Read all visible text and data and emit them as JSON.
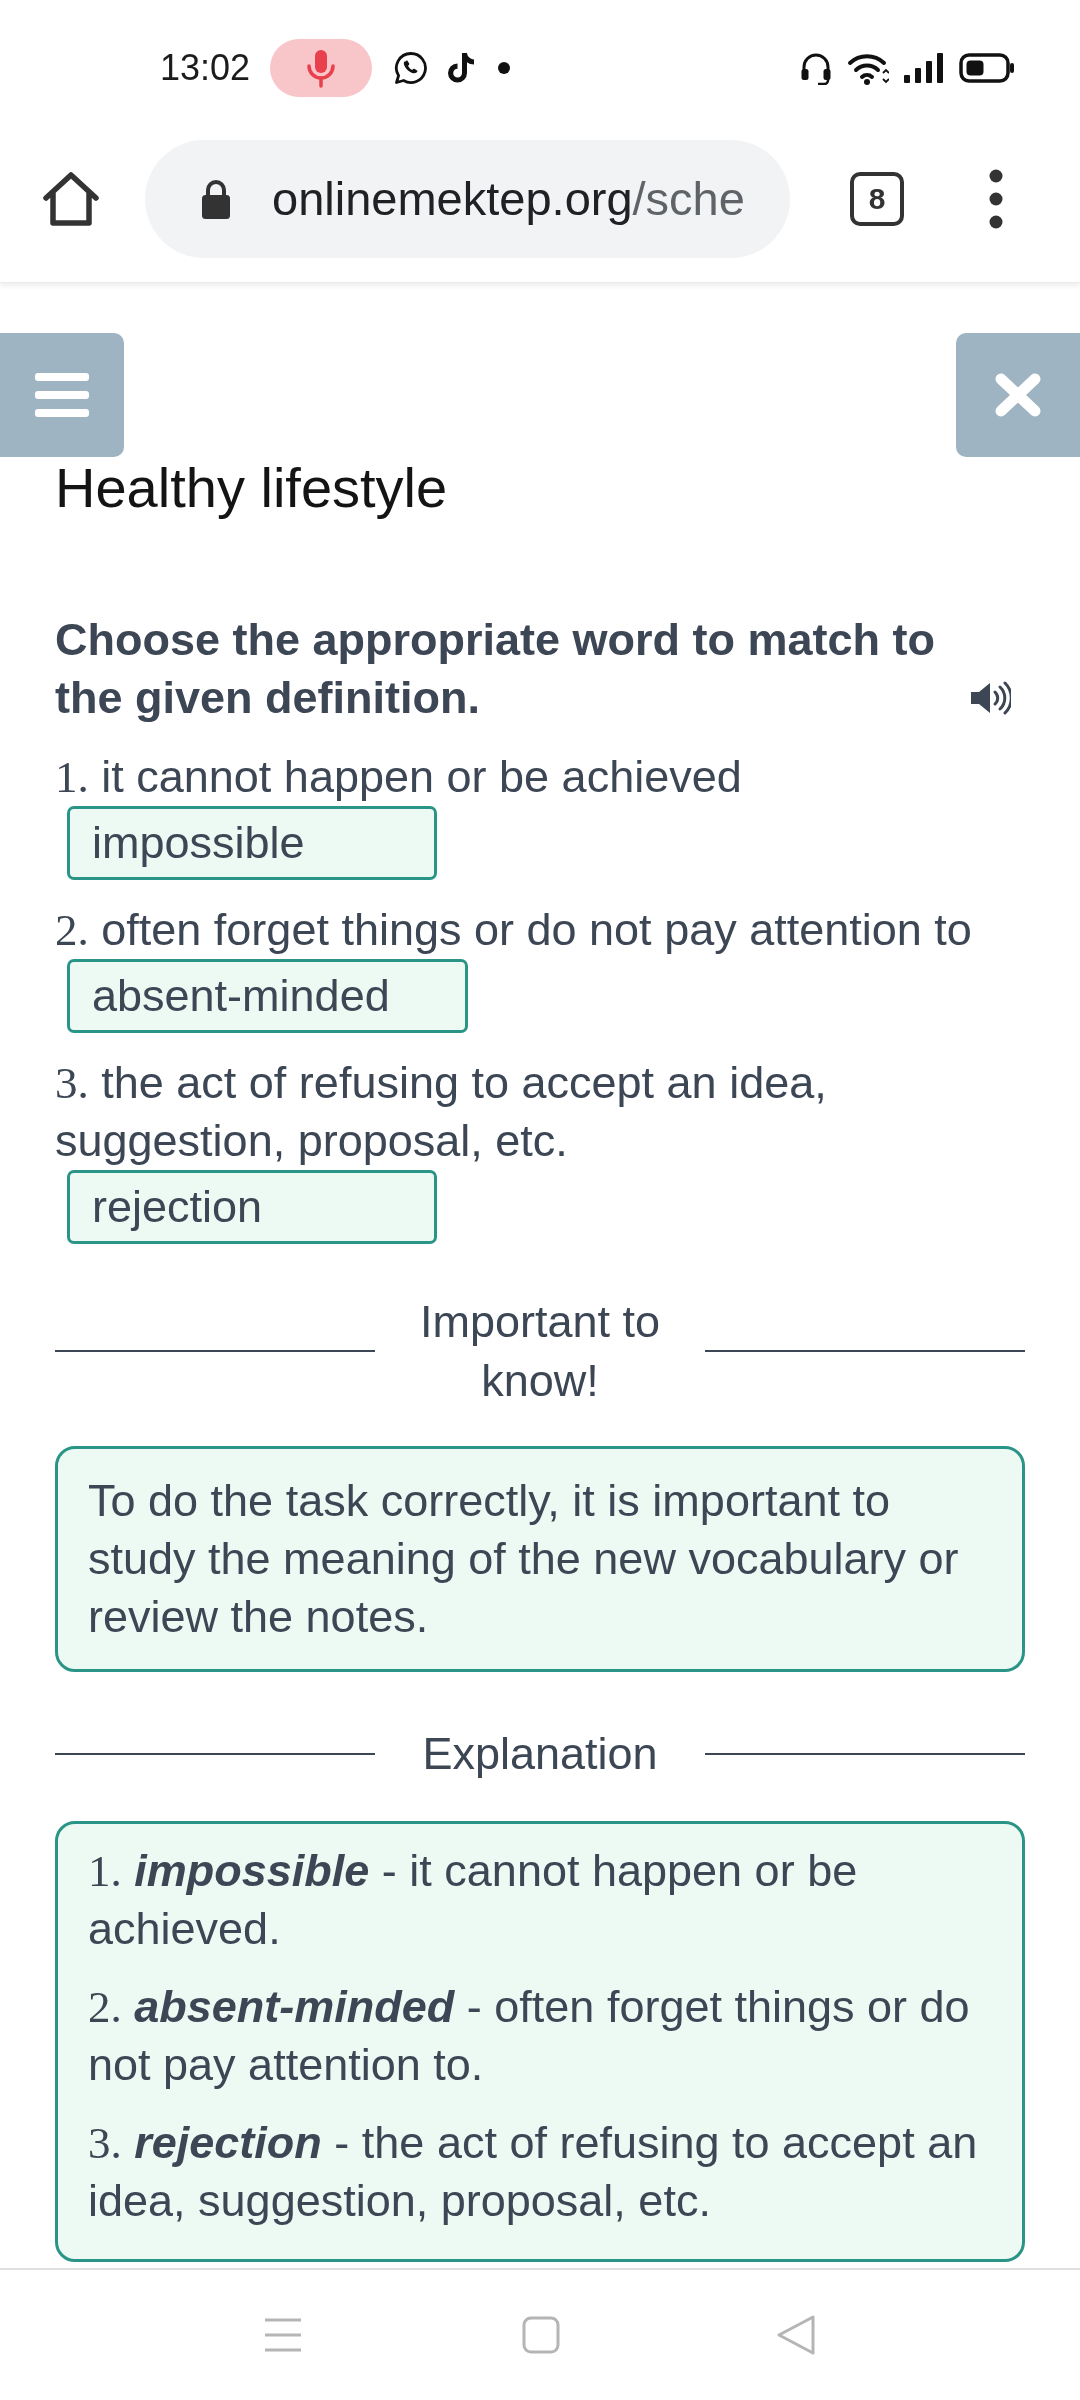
{
  "status_bar": {
    "time": "13:02"
  },
  "browser": {
    "url_domain": "onlinemektep.org",
    "url_path": "/sche",
    "tab_count": "8"
  },
  "page": {
    "title": "Healthy lifestyle",
    "instruction": "Choose the appropriate word to match to the given definition.",
    "questions": [
      {
        "number": "1.",
        "text": "it cannot happen or be achieved",
        "answer": "impossible"
      },
      {
        "number": "2.",
        "text": "often forget things or do not pay attention to",
        "answer": "absent-minded"
      },
      {
        "number": "3.",
        "text": "the act of refusing to accept an idea, suggestion, proposal, etc.",
        "answer": "rejection"
      }
    ],
    "important": {
      "heading": "Important to know!",
      "text": "To do the task correctly, it is important to study the meaning of the new vocabulary or review the notes."
    },
    "explanation": {
      "heading": "Explanation",
      "items": [
        {
          "number": "1.",
          "term": "impossible",
          "definition": "- it cannot happen or be achieved."
        },
        {
          "number": "2.",
          "term": "absent-minded",
          "definition": "- often forget things or do not pay attention to."
        },
        {
          "number": "3.",
          "term": "rejection",
          "definition": "- the act of refusing to accept an idea, suggestion, proposal, etc."
        }
      ]
    }
  }
}
